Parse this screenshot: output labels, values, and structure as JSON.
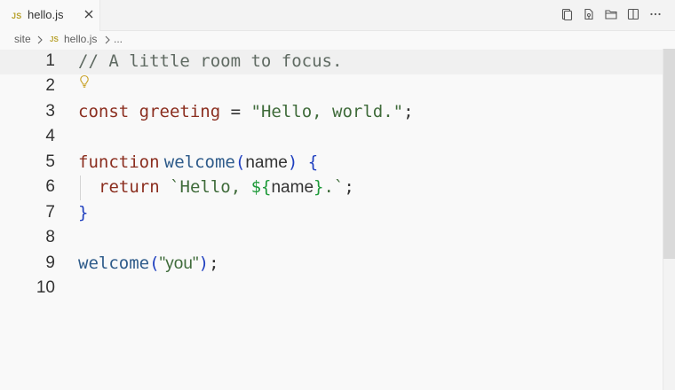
{
  "tab": {
    "badge": "JS",
    "label": "hello.js",
    "close_icon": "close-icon"
  },
  "editor_actions": [
    {
      "icon": "open-changes-icon"
    },
    {
      "icon": "source-control-icon"
    },
    {
      "icon": "open-folder-icon"
    },
    {
      "icon": "split-editor-icon"
    },
    {
      "icon": "more-actions-icon"
    }
  ],
  "breadcrumb": {
    "folder": "site",
    "file_badge": "JS",
    "file": "hello.js",
    "symbol": "..."
  },
  "editor": {
    "line_numbers": [
      "1",
      "2",
      "3",
      "4",
      "5",
      "6",
      "7",
      "8",
      "9",
      "10"
    ],
    "current_line": 1,
    "lightbulb_icon": "lightbulb-icon",
    "lines": {
      "l1": {
        "comment": "// A little room to focus."
      },
      "l3": {
        "kw": "const",
        "name": "greeting",
        "op": " = ",
        "str": "\"Hello, world.\"",
        "end": ";"
      },
      "l5": {
        "kw": "function",
        "name": "welcome",
        "open": "(",
        "param": "name",
        "close": ")",
        "brace": " {"
      },
      "l6": {
        "kw": "return",
        "str_start": " `Hello, ",
        "interp_open": "${",
        "interp_name": "name",
        "interp_close": "}",
        "str_end": ".`",
        "end": ";"
      },
      "l7": {
        "brace": "}"
      },
      "l9": {
        "name": "welcome",
        "open": "(",
        "str": "\"you\"",
        "close": ")",
        "end": ";"
      }
    }
  },
  "colors": {
    "comment": "#5f6a62",
    "keyword": "#8b2e1f",
    "string": "#3f6b3a",
    "function": "#2e5b8a",
    "bracket": "#1f3fbf",
    "interpolation": "#1f9a3a"
  }
}
